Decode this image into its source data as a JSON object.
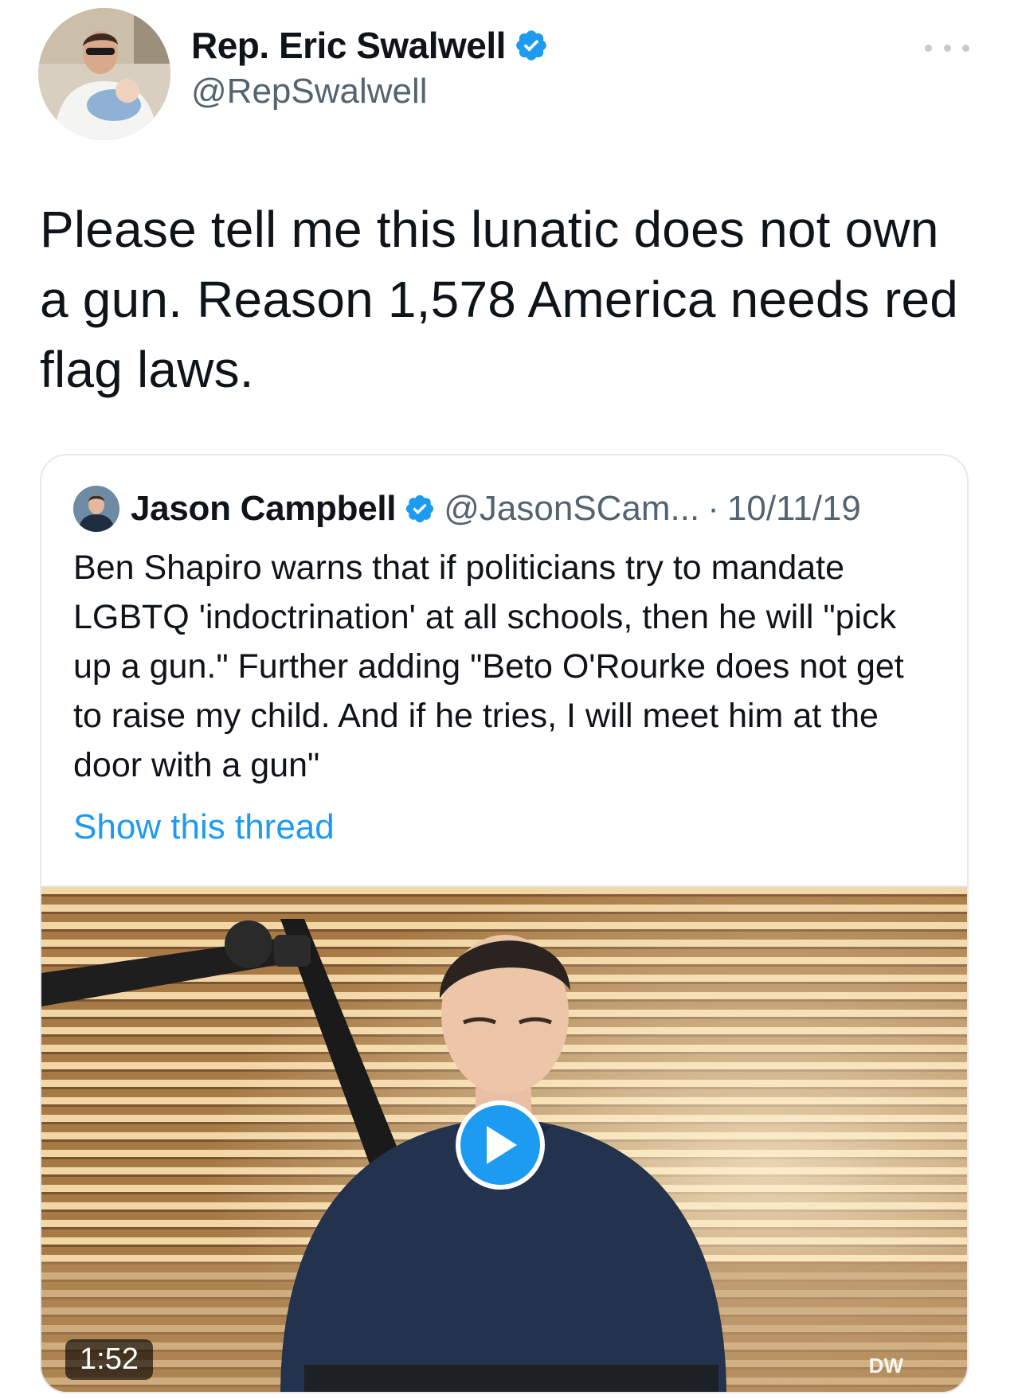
{
  "tweet": {
    "author_name": "Rep. Eric Swalwell",
    "author_handle": "@RepSwalwell",
    "text": "Please tell me this lunatic does not own a gun. Reason 1,578 America needs red flag laws."
  },
  "quoted_tweet": {
    "author_name": "Jason Campbell",
    "author_handle": "@JasonSCam...",
    "separator": "·",
    "date": "10/11/19",
    "text": "Ben Shapiro warns that if politicians try to mandate LGBTQ 'indoctrination' at all schools, then he will \"pick up a gun.\" Further adding \"Beto O'Rourke does not get to raise my child. And if he tries, I will meet him at the door with a gun\"",
    "thread_link": "Show this thread",
    "video": {
      "duration": "1:52",
      "watermark": "DW"
    }
  },
  "icons": {
    "verified": "verified-badge-icon",
    "more": "more-options-icon",
    "play": "play-icon"
  },
  "colors": {
    "accent": "#1d9bf0",
    "text_primary": "#0f1419",
    "text_secondary": "#536471",
    "border": "#e5e9ec"
  }
}
